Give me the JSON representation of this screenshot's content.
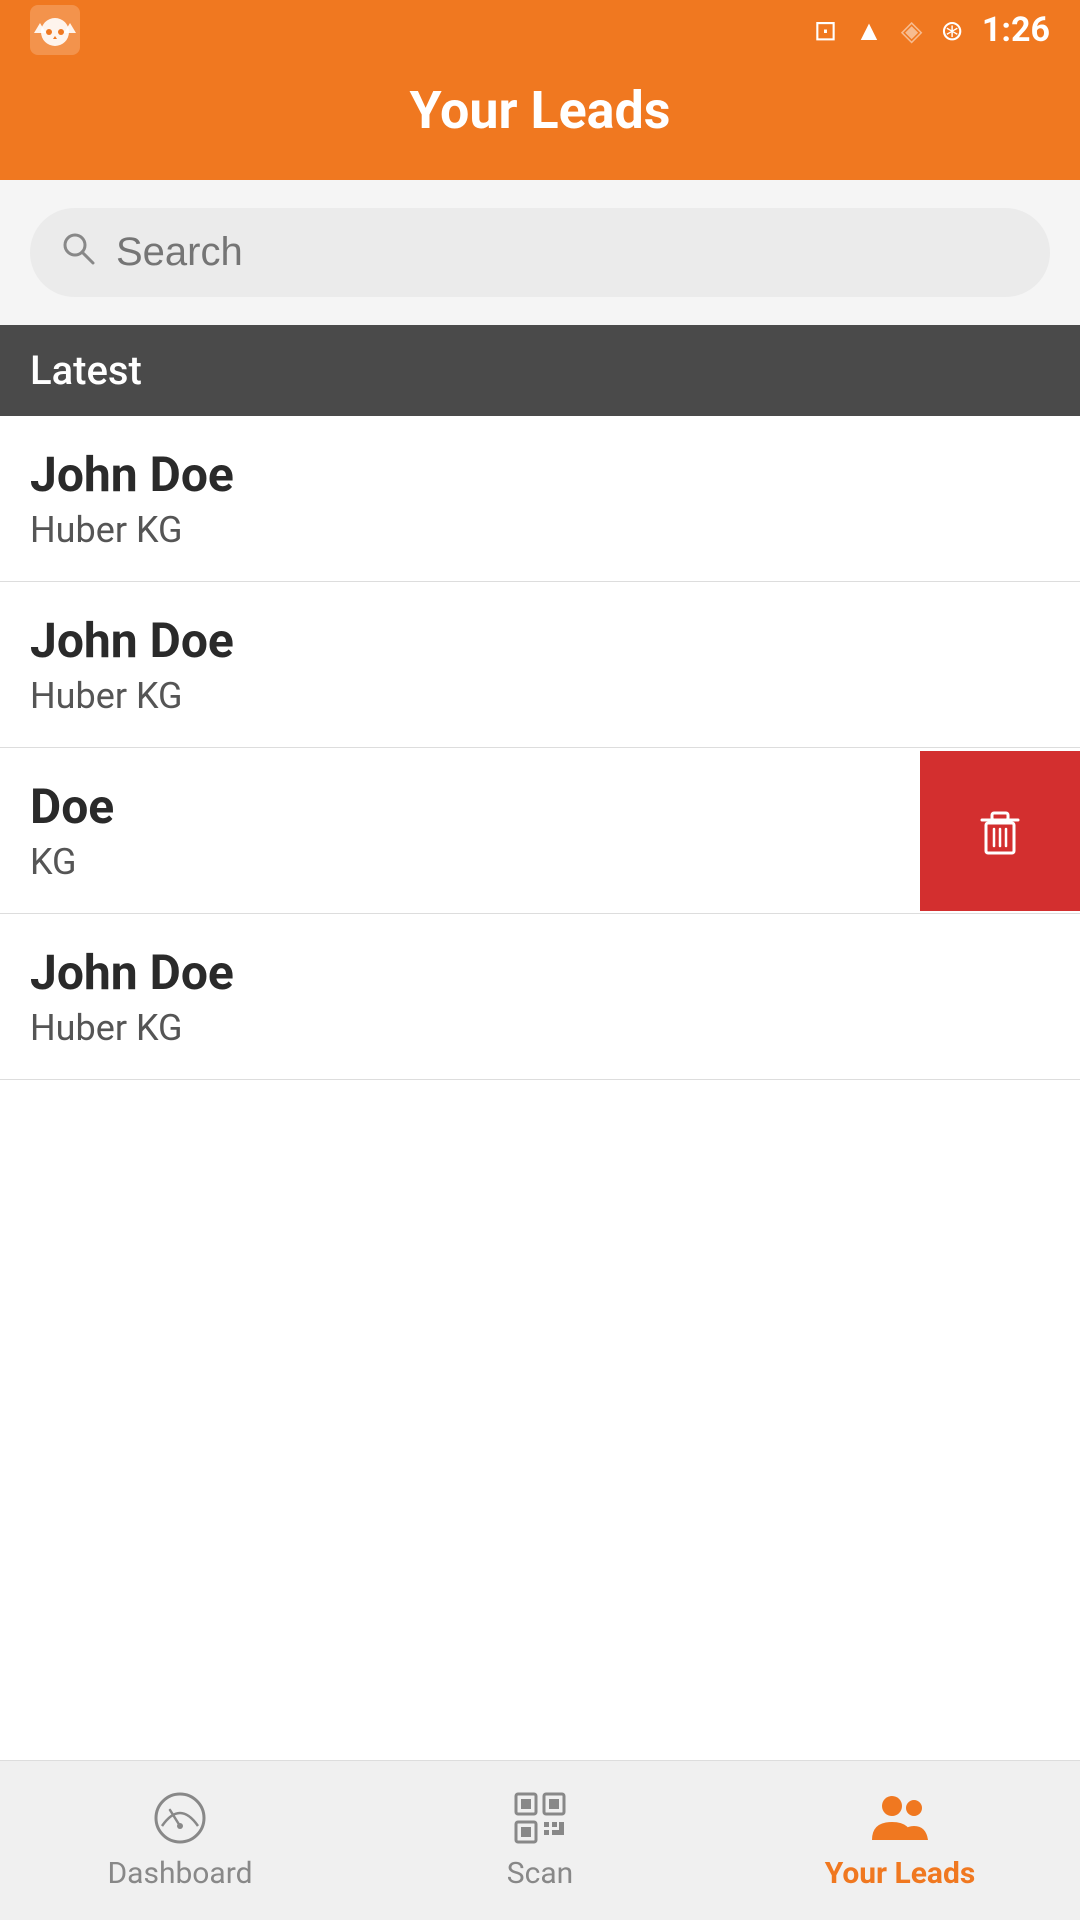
{
  "statusBar": {
    "time": "1:26"
  },
  "header": {
    "title": "Your Leads"
  },
  "search": {
    "placeholder": "Search"
  },
  "section": {
    "label": "Latest"
  },
  "leads": [
    {
      "id": 1,
      "name": "John Doe",
      "company": "Huber KG",
      "swiped": false
    },
    {
      "id": 2,
      "name": "John Doe",
      "company": "Huber KG",
      "swiped": false
    },
    {
      "id": 3,
      "name": "Doe",
      "company": "KG",
      "swiped": true
    },
    {
      "id": 4,
      "name": "John Doe",
      "company": "Huber KG",
      "swiped": false
    }
  ],
  "bottomNav": {
    "items": [
      {
        "id": "dashboard",
        "label": "Dashboard",
        "active": false
      },
      {
        "id": "scan",
        "label": "Scan",
        "active": false
      },
      {
        "id": "your-leads",
        "label": "Your Leads",
        "active": true
      }
    ]
  },
  "colors": {
    "primary": "#F07820",
    "deleteRed": "#d32f2f",
    "sectionBg": "#4a4a4a"
  }
}
